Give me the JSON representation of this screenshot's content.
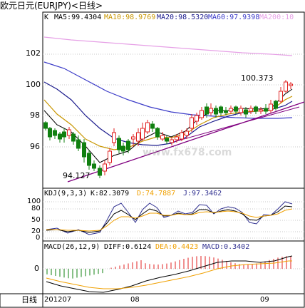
{
  "header": {
    "title": "欧元日元(EURJPY)<日线>"
  },
  "main_panel": {
    "label_k": "K",
    "ma": [
      {
        "label": "MA5:99.4304",
        "color": "#000000"
      },
      {
        "label": "MA10:98.9769",
        "color": "#c89600"
      },
      {
        "label": "MA20:98.5320",
        "color": "#1a1a8c"
      },
      {
        "label": "MA60:97.9398",
        "color": "#3c3cc8"
      },
      {
        "label": "MA200:10",
        "color": "#e6a0e6"
      }
    ],
    "y_ticks": [
      "102",
      "100",
      "98",
      "96"
    ],
    "annot_high": "100.373",
    "annot_low": "94.127"
  },
  "kdj_panel": {
    "header": "KDJ(9,3,3)",
    "k": "K:82.3079",
    "d": "D:74.7887",
    "j": "J:97.3462",
    "y_ticks": [
      "100",
      "80",
      "50",
      "20",
      "0"
    ]
  },
  "macd_panel": {
    "header": "MACD(26,12,9)",
    "diff": "DIFF:0.6124",
    "dea": "DEA:0.4423",
    "macd": "MACD:0.3402",
    "y_ticks": [
      "0"
    ]
  },
  "footer": {
    "period": "日线",
    "date_labels": [
      "201207",
      "08",
      "09"
    ]
  },
  "watermark": "www.fx678.com",
  "colors": {
    "candle_up": "#e02020",
    "candle_down": "#108010",
    "kdj_k": "#000000",
    "kdj_d": "#f0a000",
    "kdj_j": "#303090",
    "macd_diff": "#000000",
    "macd_dea": "#f0a000",
    "trendline": "#800080"
  }
}
